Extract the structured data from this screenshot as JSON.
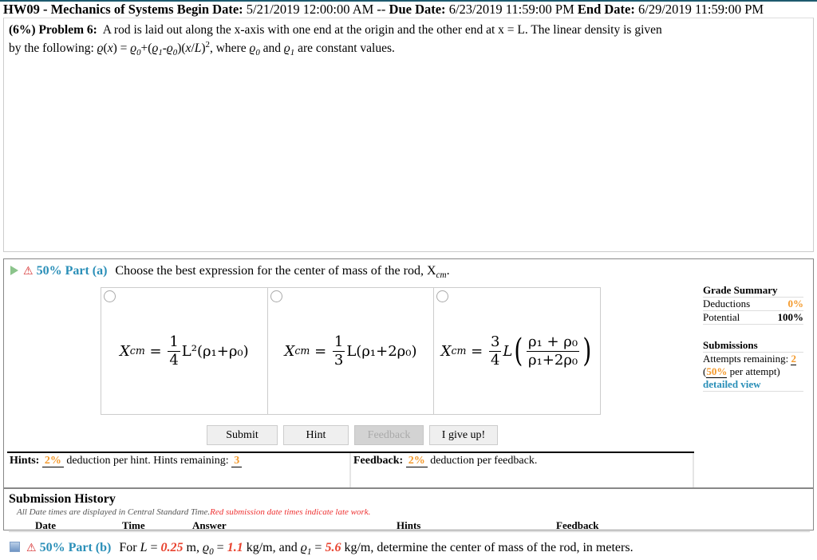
{
  "header": {
    "assignment": "HW09 - Mechanics of Systems",
    "begin_label": "Begin Date:",
    "begin_value": "5/21/2019 12:00:00 AM",
    "sep": "--",
    "due_label": "Due Date:",
    "due_value": "6/23/2019 11:59:00 PM",
    "end_label": "End Date:",
    "end_value": "6/29/2019 11:59:00 PM"
  },
  "problem": {
    "weight": "(6%)",
    "label": "Problem 6:",
    "text1": "A rod is laid out along the x-axis with one end at the origin and the other end at x = L. The linear density is given",
    "text2_prefix": "by the following:",
    "formula": "ϱ(x) = ϱ0+(ϱ1-ϱ0)(x/L)2",
    "text2_suffix": ", where ϱ0 and ϱ1 are constant values."
  },
  "part_a": {
    "percent_label": "50% Part (a)",
    "prompt": "Choose the best expression for the center of mass of the rod, X",
    "prompt_sub": "cm",
    "choices": [
      {
        "lhs": "X",
        "lhs_sub": "cm",
        "num": "1",
        "den": "4",
        "rest": "L²(ρ₁+ρ₀)"
      },
      {
        "lhs": "X",
        "lhs_sub": "cm",
        "num": "1",
        "den": "3",
        "rest": "L(ρ₁+2ρ₀)"
      },
      {
        "lhs": "X",
        "lhs_sub": "cm",
        "num": "3",
        "den": "4",
        "rest": "L",
        "inner_num": "ρ₁ + ρ₀",
        "inner_den": "ρ₁+2ρ₀"
      }
    ],
    "buttons": {
      "submit": "Submit",
      "hint": "Hint",
      "feedback": "Feedback",
      "give_up": "I give up!"
    },
    "hints": {
      "label": "Hints:",
      "deduction": "2%",
      "text": "deduction per hint. Hints remaining:",
      "remaining": "3"
    },
    "feedback": {
      "label": "Feedback:",
      "deduction": "2%",
      "text": "deduction per feedback."
    }
  },
  "grade_summary": {
    "title": "Grade Summary",
    "deductions_label": "Deductions",
    "deductions_value": "0%",
    "potential_label": "Potential",
    "potential_value": "100%",
    "submissions_title": "Submissions",
    "attempts_label": "Attempts remaining:",
    "attempts_value": "2",
    "per_attempt_open": "(",
    "per_attempt_value": "50%",
    "per_attempt_text": "per attempt)",
    "detailed_view": "detailed view"
  },
  "submission_history": {
    "title": "Submission History",
    "note": "All Date times are displayed in Central Standard Time.",
    "note_red": "Red submission date times indicate late work.",
    "columns": [
      "Date",
      "Time",
      "Answer",
      "Hints",
      "Feedback"
    ]
  },
  "part_b": {
    "percent_label": "50% Part (b)",
    "text_for": "For",
    "L_label": "L =",
    "L_value": "0.25",
    "L_unit": "m,",
    "rho0_label": "ϱ0 =",
    "rho0_value": "1.1",
    "rho0_unit": "kg/m, and",
    "rho1_label": "ϱ1 =",
    "rho1_value": "5.6",
    "rho1_unit": "kg/m, determine the center of mass of the rod, in meters."
  }
}
